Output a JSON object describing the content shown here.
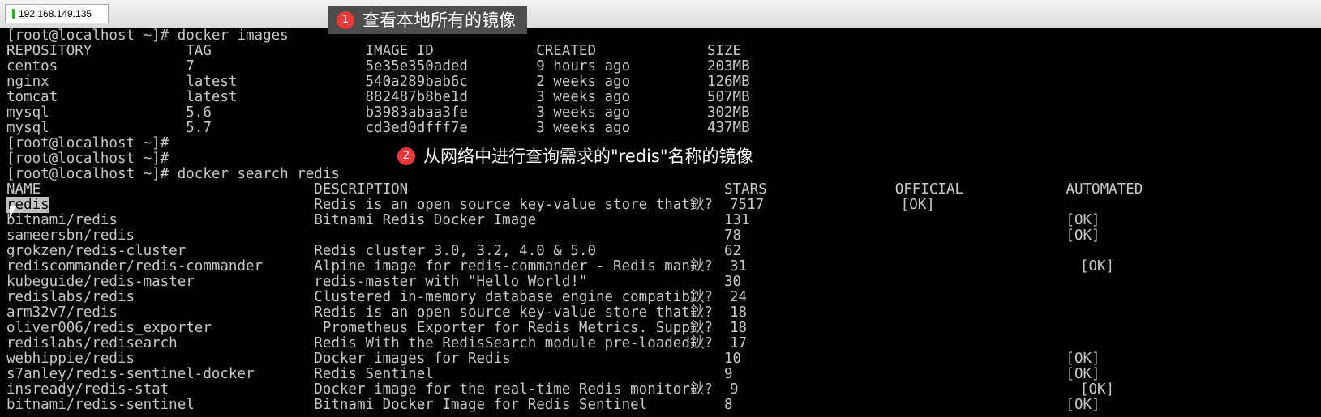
{
  "window": {
    "tab_title": "192.168.149.135"
  },
  "annotations": [
    {
      "number": "1",
      "text": "查看本地所有的镜像"
    },
    {
      "number": "2",
      "text": "从网络中进行查询需求的\"redis\"名称的镜像"
    }
  ],
  "terminal": {
    "cmd1": "[root@localhost ~]# docker images",
    "images_header": "REPOSITORY           TAG                  IMAGE ID            CREATED             SIZE",
    "images": [
      "centos               7                    5e35e350aded        9 hours ago         203MB",
      "nginx                latest               540a289bab6c        2 weeks ago         126MB",
      "tomcat               latest               882487b8be1d        3 weeks ago         507MB",
      "mysql                5.6                  b3983abaa3fe        3 weeks ago         302MB",
      "mysql                5.7                  cd3ed0dfff7e        3 weeks ago         437MB"
    ],
    "prompt1": "[root@localhost ~]#",
    "prompt2": "[root@localhost ~]#",
    "cmd2": "[root@localhost ~]# docker search redis",
    "search_header": "NAME                                DESCRIPTION                                     STARS               OFFICIAL            AUTOMATED",
    "search_first_name": "redis",
    "search_first_rest": "                               Redis is an open source key-value store that鈥?  7517                [OK]",
    "search_results": [
      "bitnami/redis                       Bitnami Redis Docker Image                      131                                     [OK]",
      "sameersbn/redis                                                                     78                                      [OK]",
      "grokzen/redis-cluster               Redis cluster 3.0, 3.2, 4.0 & 5.0               62",
      "rediscommander/redis-commander      Alpine image for redis-commander - Redis man鈥?  31                                       [OK]",
      "kubeguide/redis-master              redis-master with \"Hello World!\"                30",
      "redislabs/redis                     Clustered in-memory database engine compatib鈥?  24",
      "arm32v7/redis                       Redis is an open source key-value store that鈥?  18",
      "oliver006/redis_exporter             Prometheus Exporter for Redis Metrics. Supp鈥?  18",
      "redislabs/redisearch                Redis With the RedisSearch module pre-loaded鈥?  17",
      "webhippie/redis                     Docker images for Redis                         10                                      [OK]",
      "s7anley/redis-sentinel-docker       Redis Sentinel                                  9                                       [OK]",
      "insready/redis-stat                 Docker image for the real-time Redis monitor鈥?  9                                        [OK]",
      "bitnami/redis-sentinel              Bitnami Docker Image for Redis Sentinel         8                                       [OK]"
    ]
  },
  "colors": {
    "terminal_bg": "#000000",
    "terminal_fg": "#c7c7c7",
    "badge": "#e83a3a",
    "callout_bg": "#4d4d4d"
  },
  "icons": {
    "cursor": "mouse-cursor-icon",
    "tab_status": "connection-indicator-icon"
  }
}
